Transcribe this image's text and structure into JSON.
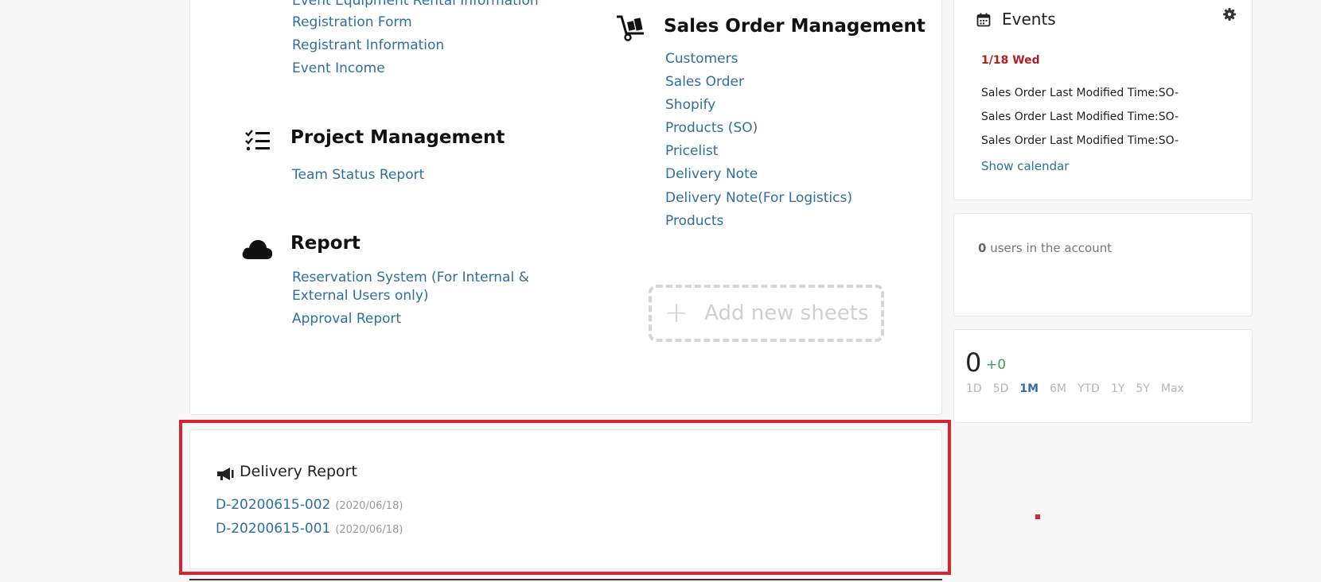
{
  "colors": {
    "link": "#2f6f9f",
    "accent_red": "#d9232d",
    "positive": "#3aa05a"
  },
  "sections": {
    "event": {
      "links": [
        "Event Equipment Rental Information",
        "Registration Form",
        "Registrant Information",
        "Event Income"
      ]
    },
    "project": {
      "title": "Project Management",
      "icon": "checklist-icon",
      "links": [
        "Team Status Report"
      ]
    },
    "report": {
      "title": "Report",
      "icon": "cloud-icon",
      "links": [
        "Reservation System (For Internal & External Users only)",
        "Approval Report"
      ]
    },
    "sales": {
      "title": "Sales Order Management",
      "icon": "hand-truck-icon",
      "links": [
        "Customers",
        "Sales Order",
        "Shopify",
        "Products (SO)",
        "Pricelist",
        "Delivery Note",
        "Delivery Note(For Logistics)",
        "Products"
      ]
    }
  },
  "add_sheets": {
    "plus": "+",
    "label": "Add new sheets"
  },
  "delivery_report": {
    "title": "Delivery Report",
    "icon": "megaphone-icon",
    "items": [
      {
        "id": "D-20200615-002",
        "date": "(2020/06/18)"
      },
      {
        "id": "D-20200615-001",
        "date": "(2020/06/18)"
      }
    ]
  },
  "events": {
    "title": "Events",
    "icon": "calendar-icon",
    "date": "1/18 Wed",
    "items": [
      "Sales Order Last Modified Time:SO-",
      "Sales Order Last Modified Time:SO-",
      "Sales Order Last Modified Time:SO-"
    ],
    "show_calendar": "Show calendar"
  },
  "users": {
    "count": "0",
    "text": "users in the account"
  },
  "stats": {
    "value": "0",
    "change": "+0",
    "ranges": [
      "1D",
      "5D",
      "1M",
      "6M",
      "YTD",
      "1Y",
      "5Y",
      "Max"
    ],
    "active_range": "1M"
  }
}
